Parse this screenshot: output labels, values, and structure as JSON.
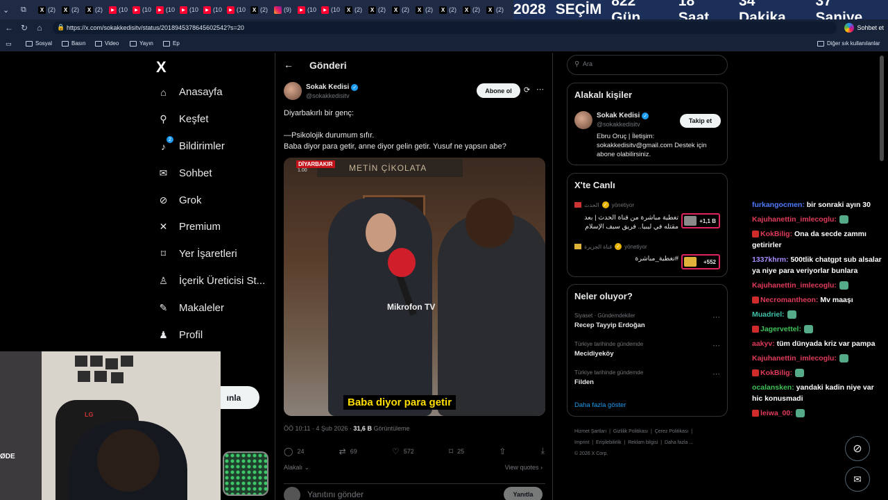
{
  "browser": {
    "tabs": [
      {
        "icon": "x",
        "label": "(2)"
      },
      {
        "icon": "x",
        "label": "(2)"
      },
      {
        "icon": "x",
        "label": "(2)"
      },
      {
        "icon": "yt",
        "label": "(10"
      },
      {
        "icon": "yt",
        "label": "(10"
      },
      {
        "icon": "yt",
        "label": "(10"
      },
      {
        "icon": "yt",
        "label": "(10"
      },
      {
        "icon": "yt",
        "label": "(10"
      },
      {
        "icon": "yt",
        "label": "(10"
      },
      {
        "icon": "x",
        "label": "(2)"
      },
      {
        "icon": "ig",
        "label": "(9)"
      },
      {
        "icon": "yt",
        "label": "(10"
      },
      {
        "icon": "yt",
        "label": "(10"
      },
      {
        "icon": "x",
        "label": "(2)"
      },
      {
        "icon": "x",
        "label": "(2)"
      },
      {
        "icon": "x",
        "label": "(2)"
      },
      {
        "icon": "x",
        "label": "(2)"
      },
      {
        "icon": "x",
        "label": "(2)"
      },
      {
        "icon": "x",
        "label": "(2)"
      },
      {
        "icon": "x",
        "label": "(2)"
      }
    ],
    "url": "https://x.com/sokakkedisitv/status/2018945378645602542?s=20",
    "chat_button": "Sohbet et",
    "bookmarks": [
      "Sosyal",
      "Basın",
      "Video",
      "Yayın",
      "Ep"
    ],
    "other_bookmarks": "Diğer sık kullanılanlar"
  },
  "countdown": {
    "year": "2028",
    "label": "SEÇİM",
    "days": "822 Gün",
    "hours": "18 Saat",
    "minutes": "34 Dakika",
    "seconds": "37 Saniye"
  },
  "nav": {
    "logo": "X",
    "items": [
      "Anasayfa",
      "Keşfet",
      "Bildirimler",
      "Sohbet",
      "Grok",
      "Premium",
      "Yer İşaretleri",
      "İçerik Üreticisi St...",
      "Makaleler",
      "Profil"
    ],
    "notif_badge": "2",
    "hidden_frag": "a",
    "post_label": "ınla"
  },
  "post": {
    "header": "Gönderi",
    "author_name": "Sokak Kedisi",
    "author_handle": "@sokakkedisitv",
    "subscribe_label": "Abone ol",
    "text_lines": [
      "Diyarbakırlı bir genç:",
      "—Psikolojik durumum sıfır.",
      "Baba diyor para getir, anne diyor gelin getir. Yusuf ne yapsın abe?"
    ],
    "media": {
      "corner_tag": "DİYARBAKIR",
      "corner_sub": "1.00",
      "shop_sign": "METİN ÇİKOLATA",
      "watermark": "Mikrofon TV",
      "subtitle": "Baba diyor para getir"
    },
    "time": "ÖÖ 10:11 · 4 Şub 2026 ·",
    "views_value": "31,6 B",
    "views_label": "Görüntüleme",
    "replies": "24",
    "reposts": "69",
    "likes": "572",
    "bookmarks": "25",
    "related_label": "Alakalı",
    "quotes_label": "View quotes",
    "reply_placeholder": "Yanıtını gönder",
    "reply_button": "Yanıtla"
  },
  "sidebar": {
    "search_placeholder": "Ara",
    "related_title": "Alakalı kişiler",
    "related_person": {
      "name": "Sokak Kedisi",
      "handle": "@sokakkedisitv",
      "follow_label": "Takip et",
      "bio": "Ebru Oruç | İletişim: sokakkedisitv@gmail.com Destek için abone olabilirsiniz."
    },
    "live_title": "X'te Canlı",
    "live": [
      {
        "source": "الحدث",
        "role": "yönetiyor",
        "title": "تغطية مباشرة من قناة الحدث | بعد مقتله في ليبيا.. فريق سيف الإسلام",
        "count": "+1,1 B"
      },
      {
        "source": "قناة الجزيرة",
        "role": "yönetiyor",
        "title": "#تغطية_مباشرة",
        "count": "+552"
      }
    ],
    "trends_title": "Neler oluyor?",
    "trends": [
      {
        "context": "Siyaset · Gündemdekiler",
        "name": "Recep Tayyip Erdoğan"
      },
      {
        "context": "Türkiye tarihinde gündemde",
        "name": "Mecidiyeköy"
      },
      {
        "context": "Türkiye tarihinde gündemde",
        "name": "Filden"
      }
    ],
    "show_more": "Daha fazla göster",
    "footer_links": [
      "Hizmet Şartları",
      "Gizlilik Politikası",
      "Çerez Politikası",
      "Imprint",
      "Erişilebilirlik",
      "Reklam bilgisi",
      "Daha fazla ...",
      "© 2026 X Corp."
    ]
  },
  "chat": [
    {
      "user": "furkangocmen:",
      "color": "#4f7cff",
      "text": " bir sonraki ayın 30",
      "badge": false
    },
    {
      "user": "Kajuhanettin_imlecoglu:",
      "color": "#e03b5a",
      "text": "",
      "badge": false,
      "emote": true
    },
    {
      "user": "KokBilig:",
      "color": "#e03b5a",
      "text": " Ona da secde zammı getirirler",
      "badge": true
    },
    {
      "user": "1337khrm:",
      "color": "#a98cff",
      "text": " 500tlik chatgpt sub alsalar ya niye para veriyorlar bunlara",
      "badge": false
    },
    {
      "user": "Kajuhanettin_imlecoglu:",
      "color": "#e03b5a",
      "text": "",
      "badge": false,
      "emote": true
    },
    {
      "user": "Necromantheon:",
      "color": "#e03b5a",
      "text": " Mv maaşı",
      "badge": true
    },
    {
      "user": "Muadriel:",
      "color": "#3fc1a8",
      "text": "",
      "badge": false,
      "emote": true
    },
    {
      "user": "Jagervettel:",
      "color": "#3fc158",
      "text": "",
      "badge": true,
      "emote": true
    },
    {
      "user": "aakyv:",
      "color": "#e03b5a",
      "text": " tüm dünyada kriz var pampa",
      "badge": false
    },
    {
      "user": "Kajuhanettin_imlecoglu:",
      "color": "#e03b5a",
      "text": "",
      "badge": false,
      "emote": true
    },
    {
      "user": "KokBilig:",
      "color": "#e03b5a",
      "text": "",
      "badge": true,
      "emote": true
    },
    {
      "user": "ocalansken:",
      "color": "#3fc158",
      "text": " yandaki kadin niye var hic konusmadi",
      "badge": false
    },
    {
      "user": "leiwa_00:",
      "color": "#e03b5a",
      "text": "",
      "badge": true,
      "emote": true
    }
  ],
  "webcam": {
    "chair_brand": "LG",
    "edge_text": "ØDE"
  }
}
